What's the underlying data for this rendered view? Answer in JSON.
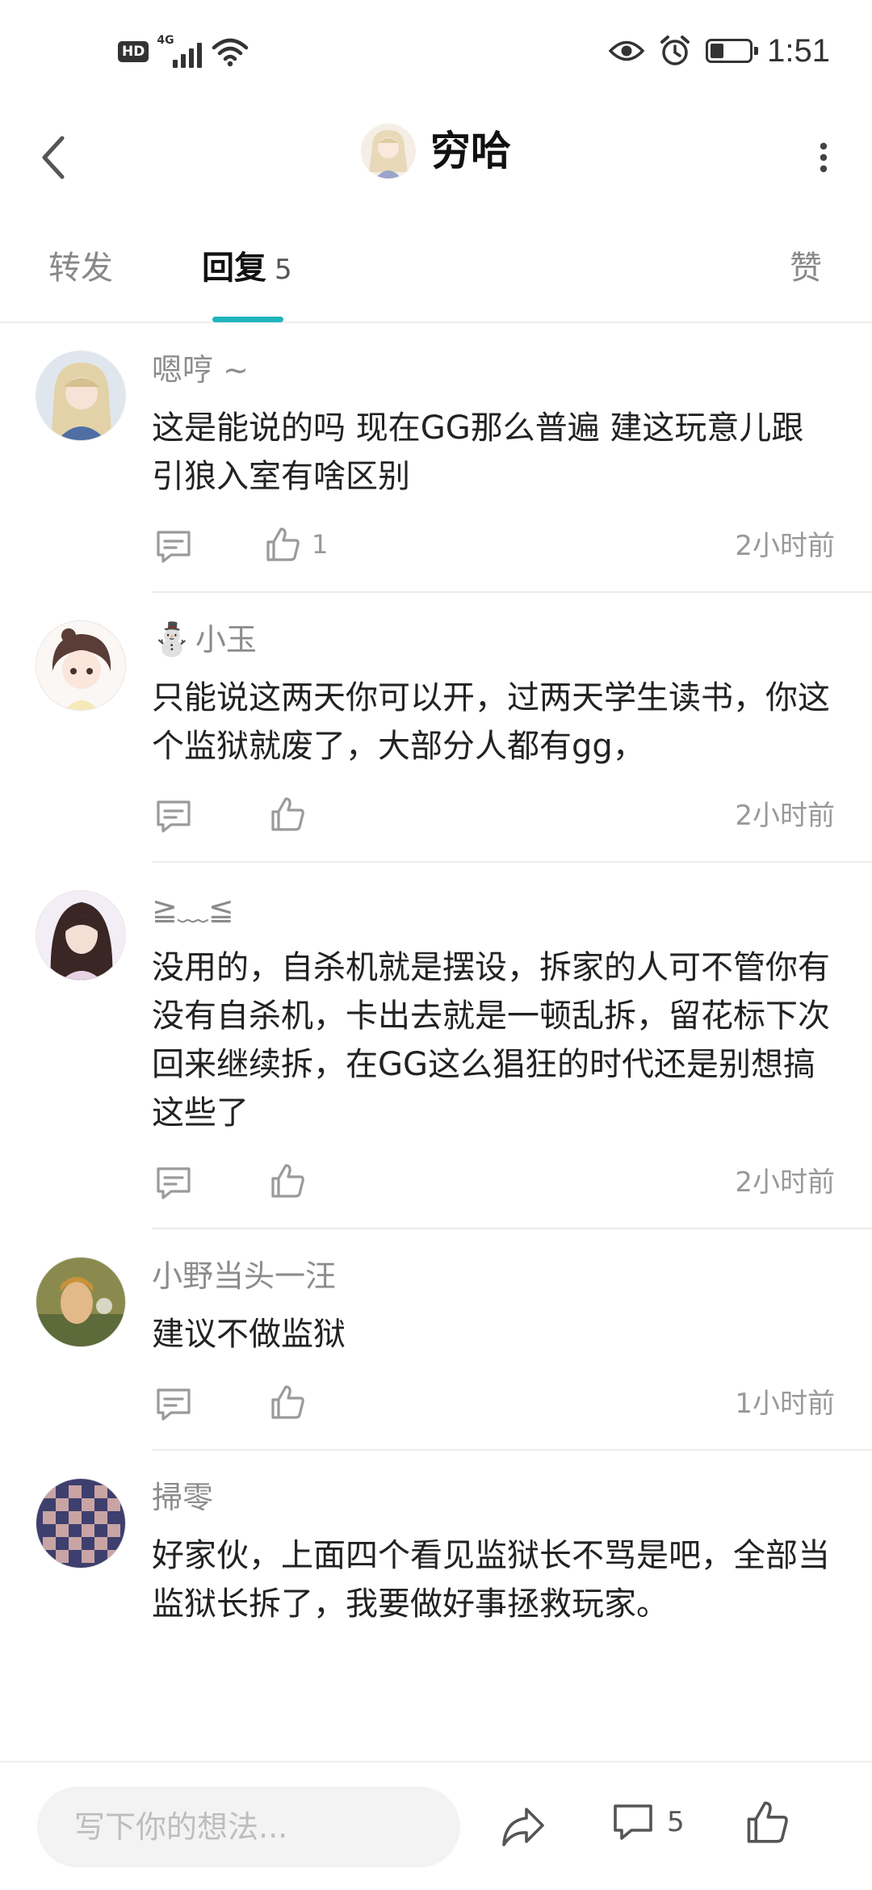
{
  "status_bar": {
    "hd_label": "HD",
    "network_label": "4G",
    "time": "1:51",
    "battery_level": 0.35
  },
  "header": {
    "title": "穷哈"
  },
  "tabs": [
    {
      "label": "转发",
      "count": ""
    },
    {
      "label": "回复",
      "count": "5"
    },
    {
      "label": "赞",
      "count": ""
    }
  ],
  "active_tab": 1,
  "comments": [
    {
      "name": "嗯哼 ~",
      "has_emoji": false,
      "text": "这是能说的吗 现在GG那么普遍 建这玩意儿跟引狼入室有啥区别",
      "likes": "1",
      "time": "2小时前"
    },
    {
      "name": "小玉",
      "has_emoji": true,
      "emoji": "⛄",
      "text": "只能说这两天你可以开，过两天学生读书，你这个监狱就废了，大部分人都有gg，",
      "likes": "",
      "time": "2小时前"
    },
    {
      "name": "≧﹏≦",
      "has_emoji": false,
      "text": "没用的，自杀机就是摆设，拆家的人可不管你有没有自杀机，卡出去就是一顿乱拆，留花标下次回来继续拆，在GG这么猖狂的时代还是别想搞这些了",
      "likes": "",
      "time": "2小时前"
    },
    {
      "name": "小野当头一汪",
      "has_emoji": false,
      "text": "建议不做监狱",
      "likes": "",
      "time": "1小时前"
    },
    {
      "name": "掃零",
      "has_emoji": false,
      "text": "好家伙，上面四个看见监狱长不骂是吧，全部当监狱长拆了，我要做好事拯救玩家。",
      "likes": "",
      "time": ""
    }
  ],
  "bottom_bar": {
    "placeholder": "写下你的想法...",
    "comment_count": "5"
  },
  "colors": {
    "accent": "#1fb5bb",
    "text_primary": "#222222",
    "text_secondary": "#8c8c8c",
    "divider": "#ececec"
  }
}
